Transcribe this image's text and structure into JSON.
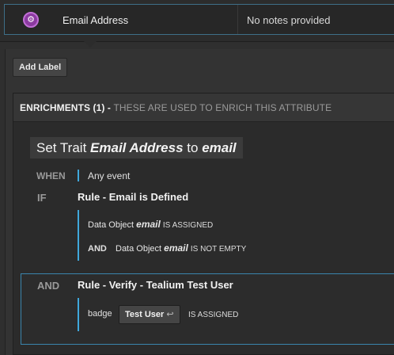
{
  "attribute": {
    "icon": "gear-icon",
    "icon_color": "#8b3aa0",
    "name": "Email Address",
    "notes": "No notes provided"
  },
  "add_label": "Add Label",
  "enrichments": {
    "title": "ENRICHMENTS (1) -",
    "description": "THESE ARE USED TO ENRICH THIS ATTRIBUTE",
    "trait": {
      "prefix": "Set Trait",
      "attribute": "Email Address",
      "middle": "to",
      "value": "email"
    },
    "when": {
      "keyword": "WHEN",
      "value": "Any event"
    },
    "if_rule": {
      "keyword": "IF",
      "title": "Rule - Email is Defined",
      "condition1": {
        "prefix": "Data Object",
        "var": "email",
        "op": "IS ASSIGNED"
      },
      "and_keyword": "AND",
      "condition2": {
        "prefix": "Data Object",
        "var": "email",
        "op": "IS NOT EMPTY"
      }
    },
    "and_rule": {
      "keyword": "AND",
      "title": "Rule - Verify - Tealium Test User",
      "condition": {
        "prefix": "badge",
        "pill": "Test User",
        "pill_icon": "undo-arrow-icon",
        "op": "IS ASSIGNED"
      }
    }
  },
  "accent_color": "#3fa8dc"
}
